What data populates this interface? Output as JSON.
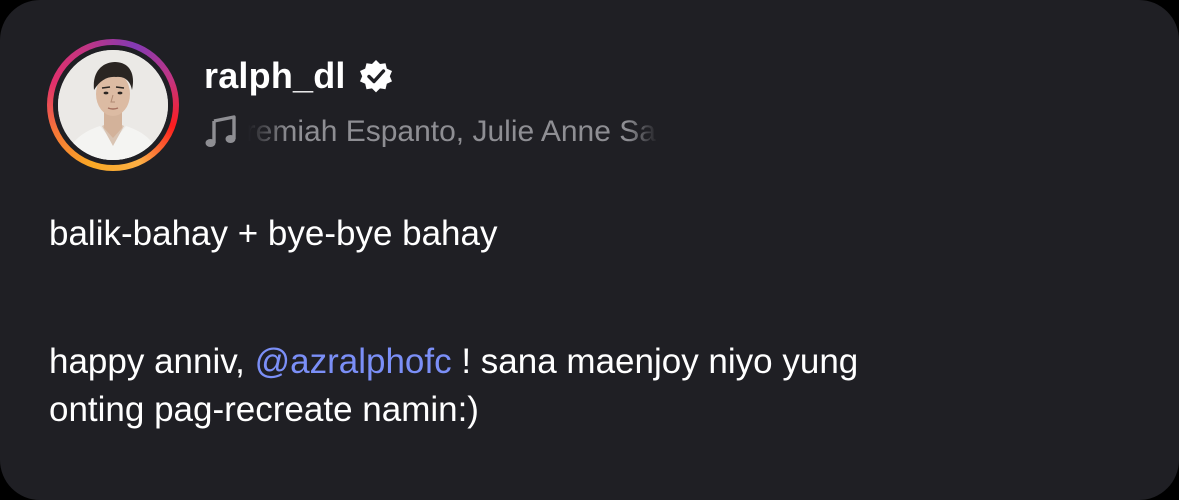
{
  "post": {
    "username": "ralph_dl",
    "music_text": "Jeremiah Espanto, Julie Anne San",
    "caption": {
      "line1": "balik-bahay + bye-bye bahay",
      "line2_before": "happy anniv, ",
      "mention": "@azralphofc",
      "line2_after": " ! sana maenjoy niyo yung",
      "line3": "onting pag-recreate namin:)"
    }
  },
  "colors": {
    "background": "#1f1f24",
    "text": "#ffffff",
    "muted": "#8e8e93",
    "mention": "#7b8ff7"
  },
  "icons": {
    "verified": "verified-badge-icon",
    "music": "music-note-icon"
  }
}
